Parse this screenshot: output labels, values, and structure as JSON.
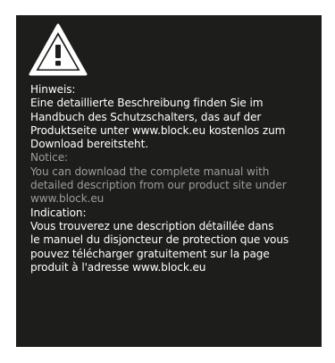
{
  "icon": {
    "name": "warning-triangle-icon",
    "glyph": "!",
    "color": "#ffffff",
    "background": "#1d1d1b"
  },
  "sections": {
    "de": {
      "heading": "Hinweis:",
      "lines": [
        "Eine detaillierte Beschreibung finden Sie im",
        "Handbuch des Schutzschalters, das auf der",
        "Produktseite unter www.block.eu kostenlos zum",
        "Download bereitsteht."
      ]
    },
    "en": {
      "heading": "Notice:",
      "lines": [
        "You can download the complete manual with",
        "detailed description from our product site under",
        "www.block.eu"
      ]
    },
    "fr": {
      "heading": "Indication:",
      "lines": [
        "Vous trouverez une description détaillée dans",
        "le manuel du disjoncteur de protection que vous",
        "pouvez télécharger gratuitement sur la page",
        "produit à l'adresse www.block.eu"
      ]
    }
  },
  "colors": {
    "panel": "#1d1d1b",
    "text_primary": "#ffffff",
    "text_secondary": "#9d9c9a"
  }
}
